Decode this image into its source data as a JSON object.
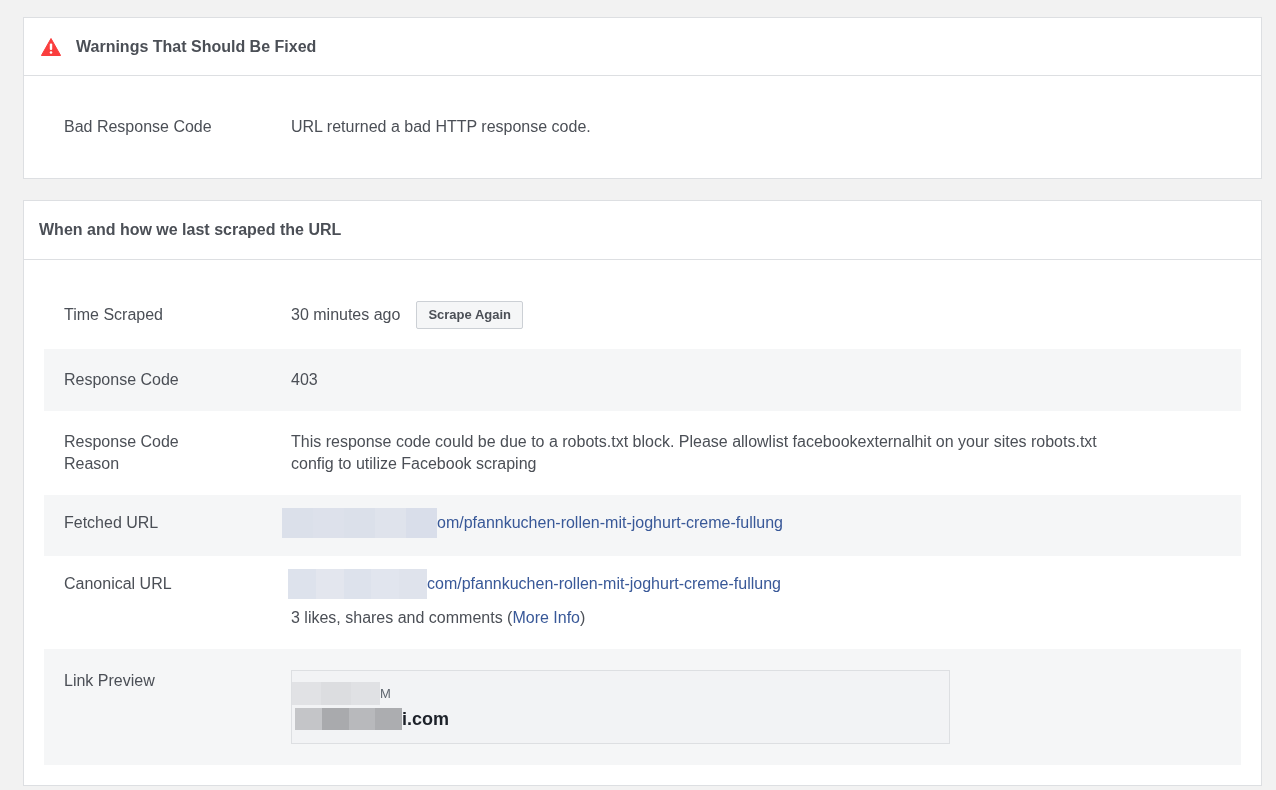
{
  "warnings_panel": {
    "title": "Warnings That Should Be Fixed",
    "rows": [
      {
        "label": "Bad Response Code",
        "value": "URL returned a bad HTTP response code."
      }
    ]
  },
  "scrape_panel": {
    "title": "When and how we last scraped the URL",
    "rows": [
      {
        "kind": "time",
        "label": "Time Scraped",
        "value": "30 minutes ago",
        "button": "Scrape Again"
      },
      {
        "kind": "text",
        "label": "Response Code",
        "value": "403"
      },
      {
        "kind": "text",
        "label": "Response Code Reason",
        "value": "This response code could be due to a robots.txt block. Please allowlist facebookexternalhit on your sites robots.txt config to utilize Facebook scraping"
      },
      {
        "kind": "url",
        "label": "Fetched URL",
        "link": "om/pfannkuchen-rollen-mit-joghurt-creme-fullung"
      },
      {
        "kind": "url",
        "label": "Canonical URL",
        "link": "com/pfannkuchen-rollen-mit-joghurt-creme-fullung",
        "engagement": {
          "before": "3 likes, shares and comments (",
          "link": "More Info",
          "after": ")"
        }
      },
      {
        "kind": "preview",
        "label": "Link Preview",
        "caption": "M",
        "domain": "i.com"
      }
    ]
  }
}
